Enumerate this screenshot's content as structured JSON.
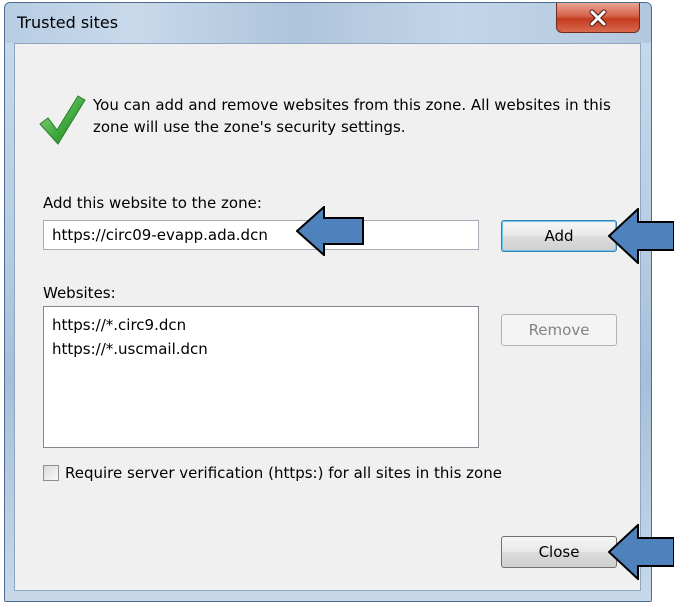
{
  "window": {
    "title": "Trusted sites"
  },
  "info": {
    "message": "You can add and remove websites from this zone. All websites in this zone will use the zone's security settings."
  },
  "add_section": {
    "label": "Add this website to the zone:",
    "url_value": "https://circ09-evapp.ada.dcn",
    "add_button": "Add"
  },
  "websites": {
    "label": "Websites:",
    "items": [
      "https://*.circ9.dcn",
      "https://*.uscmail.dcn"
    ],
    "remove_button": "Remove"
  },
  "options": {
    "require_https_label": "Require server verification (https:) for all sites in this zone",
    "require_https_checked": false
  },
  "footer": {
    "close_button": "Close"
  },
  "icons": {
    "info": "checkmark-icon",
    "close": "close-icon",
    "annotation": "arrow-left-icon"
  },
  "colors": {
    "close_button_red": "#c43b20",
    "check_green": "#3aa53a",
    "arrow_blue": "#4f81bd",
    "arrow_outline": "#000000"
  }
}
